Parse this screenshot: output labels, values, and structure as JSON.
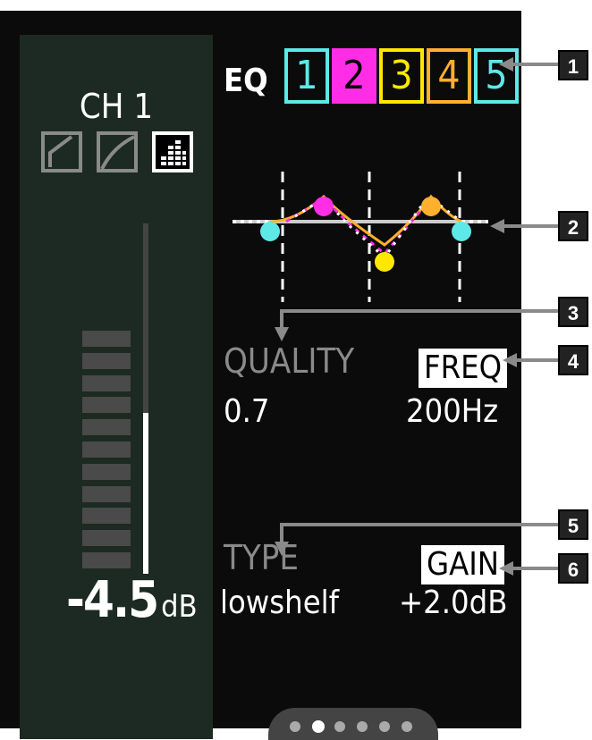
{
  "channel": {
    "title": "CH 1",
    "level_value": "-4.5",
    "level_unit": "dB",
    "fader_fraction": 0.46
  },
  "modes": [
    {
      "name": "compressor-icon",
      "active": false
    },
    {
      "name": "gate-curve-icon",
      "active": false
    },
    {
      "name": "eq-bars-icon",
      "active": true
    }
  ],
  "eq": {
    "label": "EQ",
    "bands": [
      {
        "label": "1",
        "color": "#5fe8e8",
        "bg": "#0b0b0b",
        "text": "#5fe8e8"
      },
      {
        "label": "2",
        "color": "#ff2ee6",
        "bg": "#ff2ee6",
        "text": "#000000"
      },
      {
        "label": "3",
        "color": "#ffe800",
        "bg": "#0b0b0b",
        "text": "#ffe800"
      },
      {
        "label": "4",
        "color": "#ffb02e",
        "bg": "#0b0b0b",
        "text": "#ffb02e"
      },
      {
        "label": "5",
        "color": "#5fe8e8",
        "bg": "#0b0b0b",
        "text": "#5fe8e8"
      }
    ]
  },
  "params": {
    "quality_label": "QUALITY",
    "quality_value": "0.7",
    "freq_label": "FREQ",
    "freq_value": "200Hz",
    "type_label": "TYPE",
    "type_value": "lowshelf",
    "gain_label": "GAIN",
    "gain_value": "+2.0dB"
  },
  "pager": {
    "count": 6,
    "active_index": 1
  },
  "callouts": [
    "1",
    "2",
    "3",
    "4",
    "5",
    "6"
  ]
}
